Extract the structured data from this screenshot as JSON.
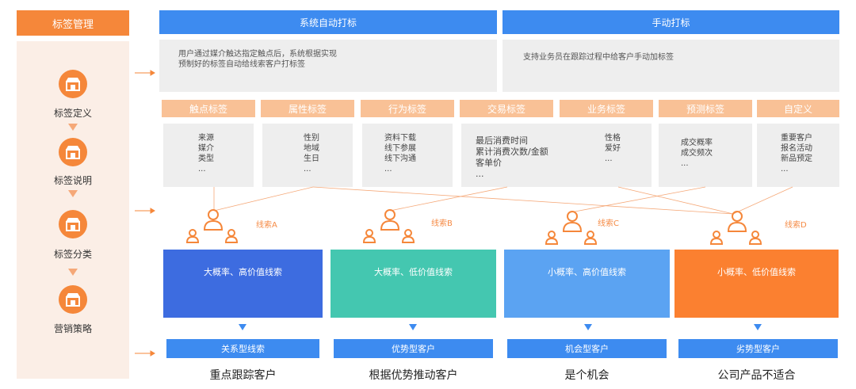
{
  "sidebar": {
    "title": "标签管理",
    "steps": [
      {
        "label": "标签定义",
        "icon": "shop-icon"
      },
      {
        "label": "标签说明",
        "icon": "shop-icon"
      },
      {
        "label": "标签分类",
        "icon": "shop-icon"
      },
      {
        "label": "营销策略",
        "icon": "shop-icon"
      }
    ]
  },
  "top": {
    "auto_title": "系统自动打标",
    "auto_desc": "用户通过媒介触达指定触点后，系统根据实现预制好的标签自动给线索客户打标签",
    "manual_title": "手动打标",
    "manual_desc": "支持业务员在跟踪过程中给客户手动加标签"
  },
  "tags": [
    {
      "header": "触点标签",
      "items": [
        "来源",
        "媒介",
        "类型",
        "..."
      ]
    },
    {
      "header": "属性标签",
      "items": [
        "性别",
        "地域",
        "生日",
        "..."
      ]
    },
    {
      "header": "行为标签",
      "items": [
        "资料下载",
        "线下参展",
        "线下沟通",
        "..."
      ]
    },
    {
      "header": "交易标签",
      "items": [
        "最后消费时间",
        "累计消费次数/金额",
        "客单价",
        "..."
      ]
    },
    {
      "header": "业务标签",
      "items": [
        "性格",
        "爱好",
        "..."
      ]
    },
    {
      "header": "预测标签",
      "items": [
        "成交概率",
        "成交频次",
        "..."
      ]
    },
    {
      "header": "自定义",
      "items": [
        "重要客户",
        "报名活动",
        "新品预定",
        "..."
      ]
    }
  ],
  "leads": [
    {
      "label": "线索A"
    },
    {
      "label": "线索B"
    },
    {
      "label": "线索C"
    },
    {
      "label": "线索D"
    }
  ],
  "quadrants": [
    {
      "label": "大概率、高价值线索",
      "color": "#3d6ce0",
      "type": "关系型线索",
      "strategy": "重点跟踪客户"
    },
    {
      "label": "大概率、低价值线索",
      "color": "#44c7b0",
      "type": "优势型客户",
      "strategy": "根据优势推动客户"
    },
    {
      "label": "小概率、高价值线索",
      "color": "#5ba3f2",
      "type": "机会型客户",
      "strategy": "是个机会"
    },
    {
      "label": "小概率、低价值线索",
      "color": "#fb8030",
      "type": "劣势型客户",
      "strategy": "公司产品不适合"
    }
  ],
  "colors": {
    "orange": "#f5873a",
    "blue": "#3d8bf0",
    "tag_header": "#f9c196",
    "gray": "#eeeeee"
  }
}
